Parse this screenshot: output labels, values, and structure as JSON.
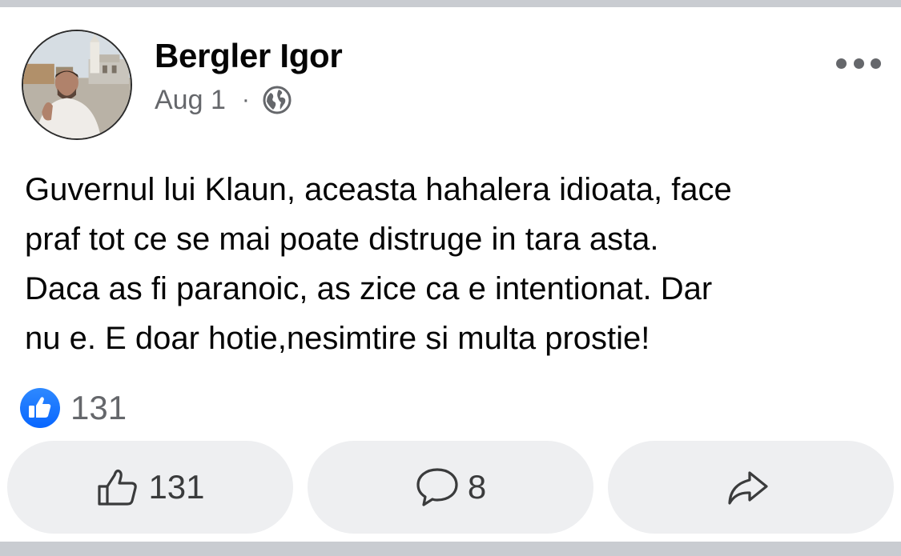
{
  "post": {
    "author": "Bergler Igor",
    "date": "Aug 1",
    "separator": "·",
    "privacy_icon": "globe-icon",
    "menu_icon": "more-horizontal-icon",
    "text": "Guvernul lui Klaun, aceasta hahalera idioata, face\npraf tot ce se mai poate distruge in tara asta.\nDaca as fi paranoic, as zice ca e intentionat. Dar\nnu e. E doar hotie,nesimtire si multa prostie!"
  },
  "reactions": {
    "icon": "like-reaction-icon",
    "count": "131"
  },
  "actions": {
    "like": {
      "icon": "thumbs-up-icon",
      "label": "131"
    },
    "comment": {
      "icon": "comment-icon",
      "label": "8"
    },
    "share": {
      "icon": "share-icon",
      "label": ""
    }
  },
  "colors": {
    "primary_text": "#050505",
    "secondary_text": "#65676b",
    "button_bg": "#eeeff1",
    "like_blue": "#1877f2",
    "divider": "#c9ccd1"
  }
}
